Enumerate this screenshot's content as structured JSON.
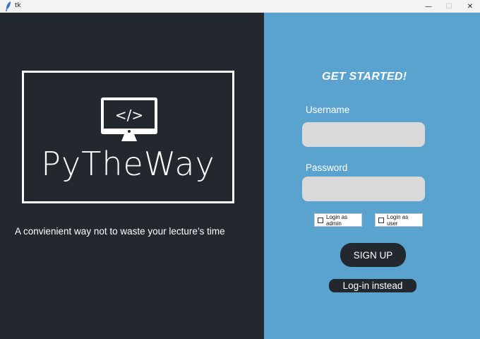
{
  "window": {
    "title": "tk",
    "minimize_glyph": "—",
    "maximize_glyph": "☐",
    "close_glyph": "✕"
  },
  "brand": {
    "logo_code": "</>",
    "name": "PyTheWay",
    "tagline": "A convienient way not to waste your lecture’s time"
  },
  "form": {
    "heading": "GET STARTED!",
    "username_label": "Username",
    "username_value": "",
    "password_label": "Password",
    "password_value": "",
    "login_as_admin": "Login as admin",
    "login_as_user": "Login as user",
    "signup_label": "SIGN UP",
    "login_instead_label": "Log-in instead"
  },
  "colors": {
    "left_panel_bg": "#23272e",
    "right_panel_bg": "#5ba3cf",
    "input_bg": "#d9d9d9",
    "button_bg": "#23272e"
  }
}
